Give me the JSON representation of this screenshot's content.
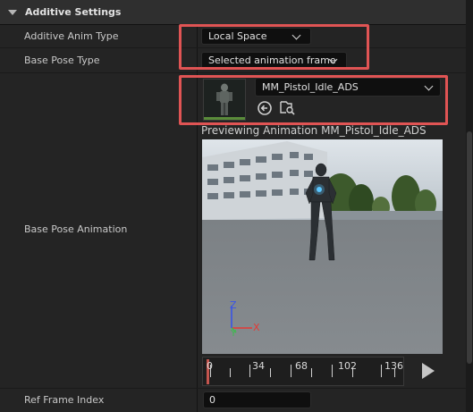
{
  "section": {
    "title": "Additive Settings"
  },
  "rows": {
    "additive_anim_type": {
      "label": "Additive Anim Type",
      "value": "Local Space"
    },
    "base_pose_type": {
      "label": "Base Pose Type",
      "value": "Selected animation frame"
    },
    "base_pose_animation": {
      "label": "Base Pose Animation",
      "asset": "MM_Pistol_Idle_ADS"
    },
    "ref_frame_index": {
      "label": "Ref Frame Index",
      "value": "0"
    }
  },
  "preview": {
    "title": "Previewing Animation MM_Pistol_Idle_ADS",
    "axes": {
      "x": "X",
      "y": "Y",
      "z": "Z"
    },
    "timeline_ticks": [
      "0",
      "34",
      "68",
      "102",
      "136"
    ],
    "playhead_frame": 0
  },
  "icons": {
    "browse": "arrow-left-circle-icon",
    "find": "find-in-browser-icon",
    "play": "play-icon"
  },
  "colors": {
    "highlight": "#e05454",
    "background": "#1a1a1a",
    "row": "#242424",
    "combo": "#0f0f0f"
  }
}
